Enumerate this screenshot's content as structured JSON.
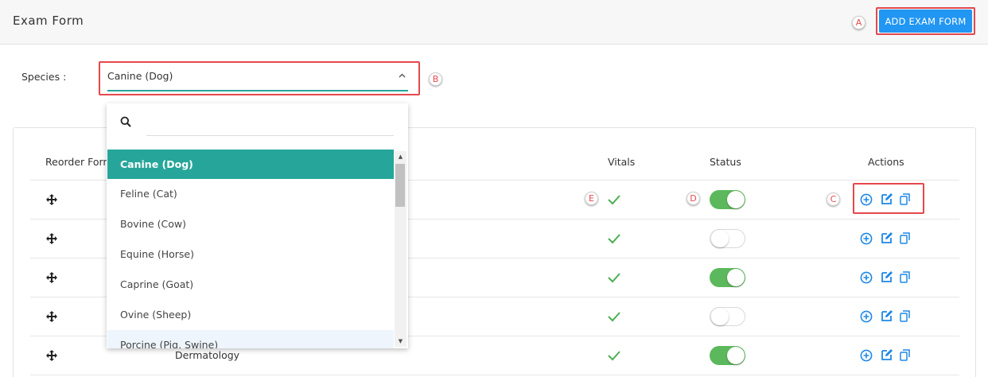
{
  "header": {
    "title": "Exam Form",
    "add_button": "ADD EXAM FORM"
  },
  "annotations": {
    "a": "A",
    "b": "B",
    "c": "C",
    "d": "D",
    "e": "E"
  },
  "species": {
    "label": "Species :",
    "selected": "Canine (Dog)",
    "search_placeholder": "",
    "options": [
      "Canine (Dog)",
      "Feline (Cat)",
      "Bovine (Cow)",
      "Equine (Horse)",
      "Caprine (Goat)",
      "Ovine (Sheep)",
      "Porcine (Pig, Swine)"
    ]
  },
  "table": {
    "headers": {
      "reorder": "Reorder Form",
      "vitals": "Vitals",
      "status": "Status",
      "actions": "Actions"
    },
    "rows": [
      {
        "name": "",
        "vitals": true,
        "status": "on"
      },
      {
        "name": "",
        "vitals": true,
        "status": "off"
      },
      {
        "name": "",
        "vitals": true,
        "status": "on"
      },
      {
        "name": "",
        "vitals": true,
        "status": "off"
      },
      {
        "name": "Dermatology",
        "vitals": true,
        "status": "on"
      }
    ]
  },
  "colors": {
    "accent_teal": "#26a69a",
    "button_blue": "#2196f3",
    "toggle_green": "#5cb85c",
    "annotation_red": "#e5484d",
    "action_blue": "#1e88e5"
  },
  "icons": [
    "drag-move-icon",
    "checkmark-icon",
    "add-circle-icon",
    "edit-icon",
    "copy-icon",
    "search-icon",
    "chevron-up-icon"
  ]
}
